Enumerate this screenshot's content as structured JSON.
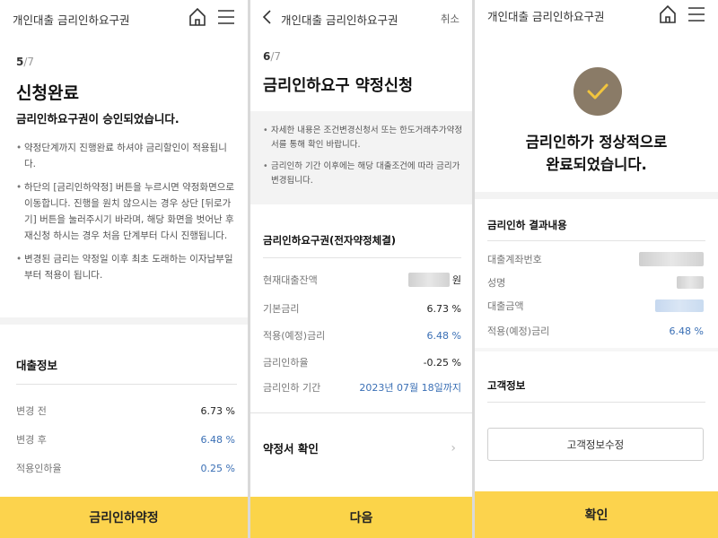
{
  "screen1": {
    "header_title": "개인대출 금리인하요구권",
    "step_current": "5",
    "step_total": "/7",
    "heading": "신청완료",
    "subheading": "금리인하요구권이 승인되었습니다.",
    "bullets": [
      "약정단계까지 진행완료 하셔야 금리할인이 적용됩니다.",
      "하단의 [금리인하약정] 버튼을 누르시면 약정화면으로 이동합니다. 진행을 원치 않으시는 경우 상단 [뒤로가기] 버튼을 눌러주시기 바라며, 해당 화면을 벗어난 후 재신청 하시는 경우 처음 단계부터 다시 진행됩니다.",
      "변경된 금리는 약정일 이후 최초 도래하는 이자납부일부터 적용이 됩니다."
    ],
    "section_title": "대출정보",
    "rows": [
      {
        "label": "변경 전",
        "value": "6.73 %"
      },
      {
        "label": "변경 후",
        "value": "6.48 %"
      },
      {
        "label": "적용인하율",
        "value": "0.25 %"
      }
    ],
    "cta_label": "금리인하약정"
  },
  "screen2": {
    "header_title": "개인대출 금리인하요구권",
    "cancel_label": "취소",
    "step_current": "6",
    "step_total": "/7",
    "heading": "금리인하요구 약정신청",
    "notices": [
      "자세한 내용은 조건변경신청서 또는 한도거래추가약정서를 통해 확인 바랍니다.",
      "금리인하 기간 이후에는 해당 대출조건에 따라 금리가 변경됩니다."
    ],
    "section_title": "금리인하요구권(전자약정체결)",
    "rows": [
      {
        "label": "현재대출잔액",
        "value": "원"
      },
      {
        "label": "기본금리",
        "value": "6.73 %"
      },
      {
        "label": "적용(예정)금리",
        "value": "6.48 %"
      },
      {
        "label": "금리인하율",
        "value": "-0.25 %"
      },
      {
        "label": "금리인하 기간",
        "value": "2023년 07월 18일까지"
      }
    ],
    "contract_link": "약정서 확인",
    "cta_label": "다음"
  },
  "screen3": {
    "header_title": "개인대출 금리인하요구권",
    "done_line1": "금리인하가 정상적으로",
    "done_line2": "완료되었습니다.",
    "result_title": "금리인하 결과내용",
    "rows": [
      {
        "label": "대출계좌번호",
        "value": ""
      },
      {
        "label": "성명",
        "value": ""
      },
      {
        "label": "대출금액",
        "value": ""
      },
      {
        "label": "적용(예정)금리",
        "value": "6.48 %"
      }
    ],
    "customer_title": "고객정보",
    "edit_button": "고객정보수정",
    "cta_label": "확인"
  },
  "colors": {
    "accent_yellow": "#fcd34d",
    "rate_blue": "#3a6fb5",
    "check_brown": "#8a7b67"
  },
  "icons": {
    "home": "home-icon",
    "menu": "menu-icon",
    "back": "back-icon",
    "check": "check-icon",
    "chevron": "chevron-right-icon"
  }
}
